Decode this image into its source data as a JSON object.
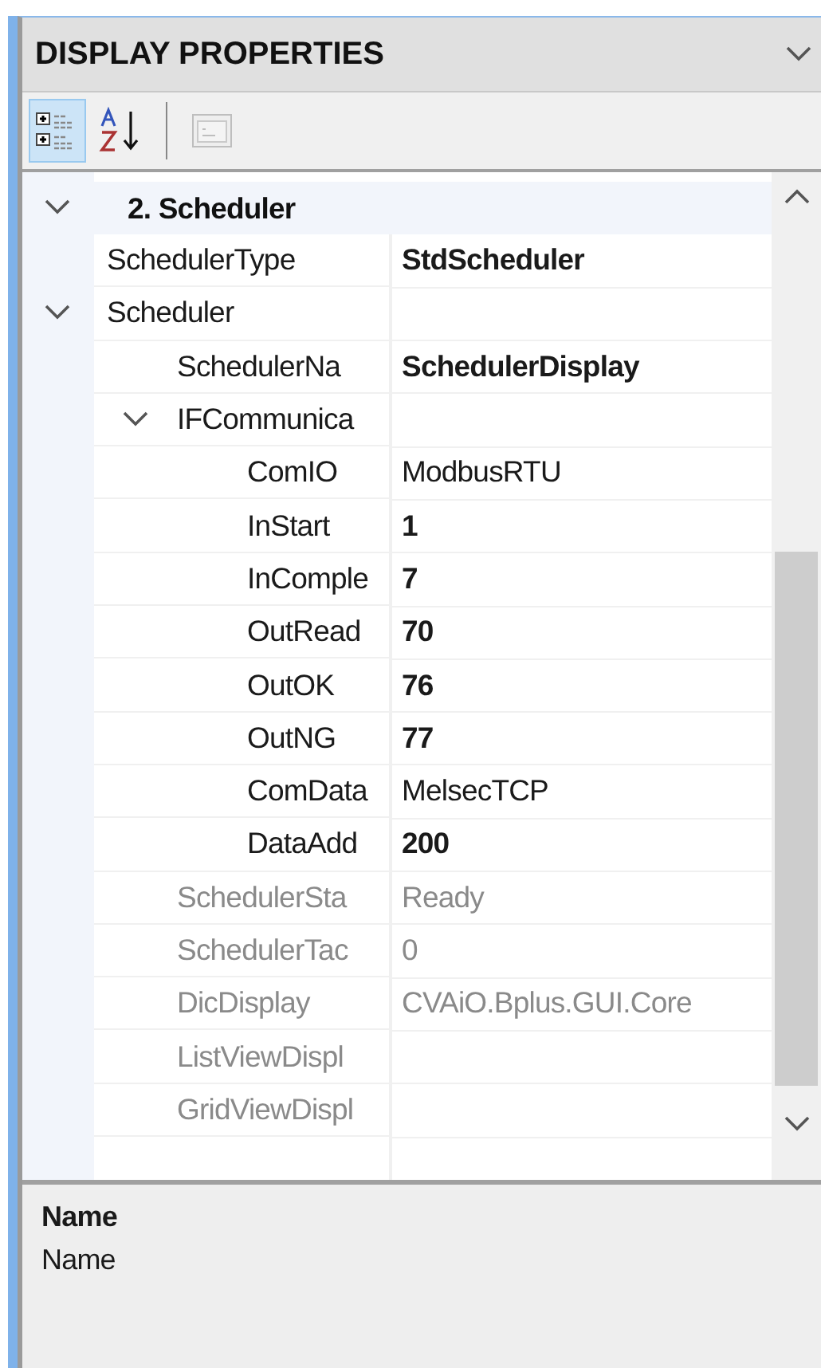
{
  "panel": {
    "title": "DISPLAY PROPERTIES"
  },
  "toolbar": [
    {
      "kind": "categorized",
      "selected": true,
      "disabled": false
    },
    {
      "kind": "alphabetical",
      "selected": false,
      "disabled": false
    },
    {
      "kind": "property-pages",
      "selected": false,
      "disabled": true
    }
  ],
  "grid": {
    "category": {
      "label": "2. Scheduler",
      "expanded": true
    },
    "properties": [
      {
        "name": "SchedulerType",
        "value": "StdScheduler",
        "modified": true,
        "readonly": false
      },
      {
        "name": "Scheduler",
        "expanded": true,
        "readonly": false,
        "children": [
          {
            "name": "SchedulerNa",
            "value": "SchedulerDisplay",
            "modified": true,
            "readonly": false
          },
          {
            "name": "IFCommunica",
            "expanded": true,
            "readonly": false,
            "children": [
              {
                "name": "ComIO",
                "value": "ModbusRTU",
                "modified": false,
                "readonly": false
              },
              {
                "name": "InStart",
                "value": "1",
                "modified": true,
                "readonly": false
              },
              {
                "name": "InComple",
                "value": "7",
                "modified": true,
                "readonly": false
              },
              {
                "name": "OutRead",
                "value": "70",
                "modified": true,
                "readonly": false
              },
              {
                "name": "OutOK",
                "value": "76",
                "modified": true,
                "readonly": false
              },
              {
                "name": "OutNG",
                "value": "77",
                "modified": true,
                "readonly": false
              },
              {
                "name": "ComData",
                "value": "MelsecTCP",
                "modified": false,
                "readonly": false
              },
              {
                "name": "DataAdd",
                "value": "200",
                "modified": true,
                "readonly": false
              }
            ]
          },
          {
            "name": "SchedulerSta",
            "value": "Ready",
            "modified": false,
            "readonly": true
          },
          {
            "name": "SchedulerTac",
            "value": "0",
            "modified": false,
            "readonly": true
          },
          {
            "name": "DicDisplay",
            "value": "CVAiO.Bplus.GUI.Core",
            "modified": false,
            "readonly": true
          },
          {
            "name": "ListViewDispl",
            "readonly": true
          },
          {
            "name": "GridViewDispl",
            "readonly": true
          }
        ]
      }
    ]
  },
  "description": {
    "title": "Name",
    "text": "Name"
  }
}
